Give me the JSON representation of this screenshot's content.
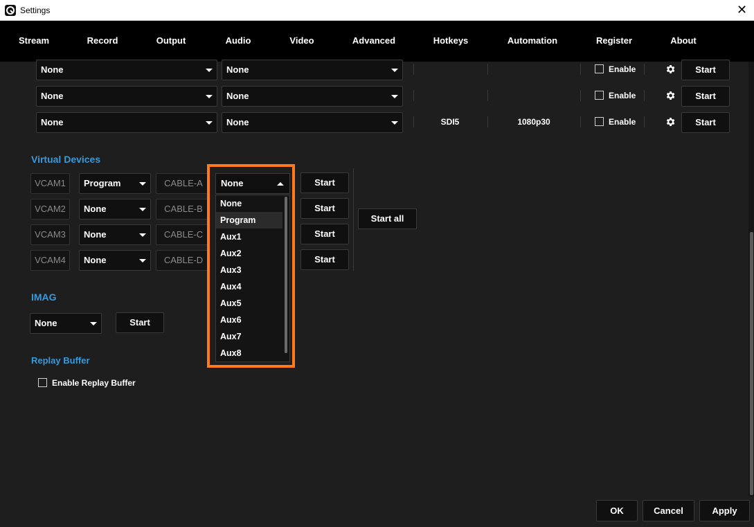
{
  "window": {
    "title": "Settings"
  },
  "tabs": [
    "Stream",
    "Record",
    "Output",
    "Audio",
    "Video",
    "Advanced",
    "Hotkeys",
    "Automation",
    "Register",
    "About"
  ],
  "active_tab": "Output",
  "output_rows": [
    {
      "source": "None",
      "target": "None",
      "device": "",
      "format": "",
      "enable_label": "Enable",
      "start_label": "Start"
    },
    {
      "source": "None",
      "target": "None",
      "device": "",
      "format": "",
      "enable_label": "Enable",
      "start_label": "Start"
    },
    {
      "source": "None",
      "target": "None",
      "device": "SDI5",
      "format": "1080p30",
      "enable_label": "Enable",
      "start_label": "Start"
    }
  ],
  "virtual_devices": {
    "title": "Virtual Devices",
    "rows": [
      {
        "name": "VCAM1",
        "source": "Program",
        "cable": "CABLE-A",
        "output": "None",
        "start_label": "Start"
      },
      {
        "name": "VCAM2",
        "source": "None",
        "cable": "CABLE-B",
        "output": "",
        "start_label": "Start"
      },
      {
        "name": "VCAM3",
        "source": "None",
        "cable": "CABLE-C",
        "output": "",
        "start_label": "Start"
      },
      {
        "name": "VCAM4",
        "source": "None",
        "cable": "CABLE-D",
        "output": "",
        "start_label": "Start"
      }
    ],
    "start_all_label": "Start all"
  },
  "dropdown": {
    "selected": "None",
    "options": [
      "None",
      "Program",
      "Aux1",
      "Aux2",
      "Aux3",
      "Aux4",
      "Aux5",
      "Aux6",
      "Aux7",
      "Aux8"
    ],
    "highlighted": "Program"
  },
  "imag": {
    "title": "IMAG",
    "source": "None",
    "start_label": "Start"
  },
  "replay_buffer": {
    "title": "Replay Buffer",
    "enable_label": "Enable Replay Buffer"
  },
  "footer": {
    "ok": "OK",
    "cancel": "Cancel",
    "apply": "Apply"
  },
  "colors": {
    "accent": "#3a9ad9",
    "highlight_box": "#ff7a1a",
    "active_tab_underline": "#2f6fd6"
  }
}
